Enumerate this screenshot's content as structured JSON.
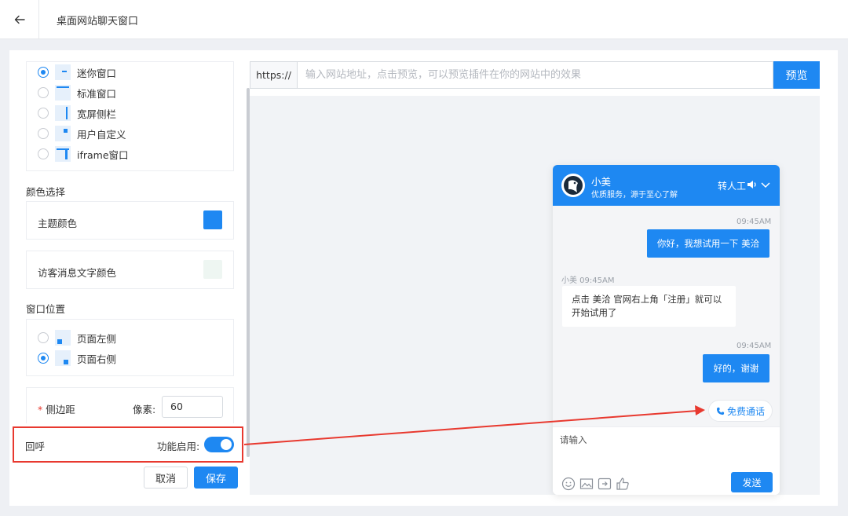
{
  "header": {
    "title": "桌面网站聊天窗口",
    "back_icon": "arrow-left-icon"
  },
  "window_style": {
    "options": [
      {
        "label": "迷你窗口",
        "selected": true
      },
      {
        "label": "标准窗口",
        "selected": false
      },
      {
        "label": "宽屏侧栏",
        "selected": false
      },
      {
        "label": "用户自定义",
        "selected": false
      },
      {
        "label": "iframe窗口",
        "selected": false
      }
    ]
  },
  "color": {
    "section_label": "颜色选择",
    "theme_label": "主题颜色",
    "theme_color": "#1e88f2",
    "visitor_text_label": "访客消息文字颜色",
    "visitor_text_color": "#eef6f2"
  },
  "position": {
    "section_label": "窗口位置",
    "options": [
      {
        "label": "页面左侧",
        "selected": false
      },
      {
        "label": "页面右侧",
        "selected": true
      }
    ]
  },
  "margin": {
    "required_mark": "*",
    "label": "侧边距",
    "unit_label": "像素:",
    "value": "60"
  },
  "callback": {
    "label": "回呼",
    "toggle_label": "功能启用:",
    "enabled": true
  },
  "actions": {
    "cancel": "取消",
    "save": "保存"
  },
  "preview": {
    "url_prefix": "https://",
    "url_placeholder": "输入网站地址，点击预览，可以预览插件在你的网站中的效果",
    "button": "预览"
  },
  "chat": {
    "agent_name": "小美",
    "agent_subtitle": "优质服务，源于至心了解",
    "transfer_label": "转人工",
    "messages": [
      {
        "from": "visitor",
        "time": "09:45AM",
        "text": "你好，我想试用一下 美洽"
      },
      {
        "from": "agent",
        "time": "小美 09:45AM",
        "lines": [
          "点击 美洽 官网右上角「注册」就可以",
          "开始试用了"
        ]
      },
      {
        "from": "visitor",
        "time": "09:45AM",
        "text": "好的，谢谢"
      }
    ],
    "call_button": "免费通话",
    "input_placeholder": "请输入",
    "send_button": "发送"
  },
  "colors": {
    "accent": "#1e88f2",
    "annotation": "#e8392f",
    "background": "#eef0f4"
  }
}
